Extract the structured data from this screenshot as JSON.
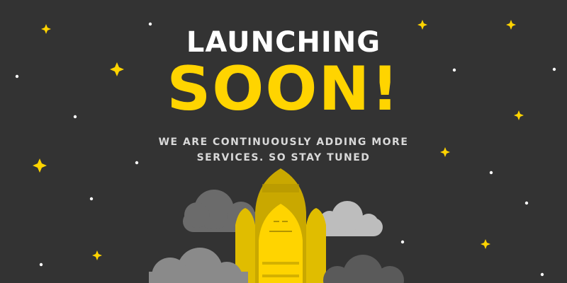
{
  "headline": {
    "line1": "LAUNCHING",
    "line2": "SOON!"
  },
  "message": {
    "line1": "WE ARE CONTINUOUSLY ADDING MORE",
    "line2": "SERVICES. SO STAY TUNED"
  },
  "colors": {
    "background": "#333333",
    "accent": "#ffd400",
    "text": "#ffffff",
    "subtext": "#d9d9d9",
    "cloud_dark": "#6b6b6b",
    "cloud_light": "#bdbdbd",
    "rocket": "#e6c300"
  },
  "icons": [
    "star-icon",
    "dot-icon",
    "cloud-icon",
    "rocket-icon"
  ]
}
